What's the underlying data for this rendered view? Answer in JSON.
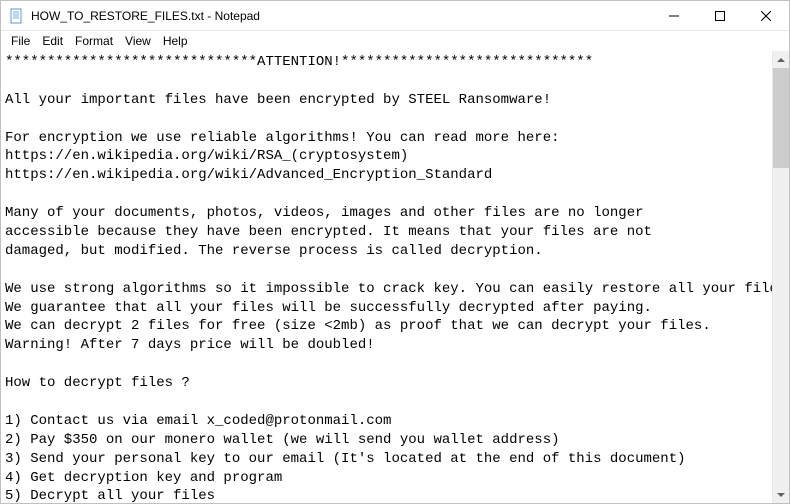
{
  "titlebar": {
    "title": "HOW_TO_RESTORE_FILES.txt - Notepad"
  },
  "menubar": {
    "items": [
      {
        "label": "File"
      },
      {
        "label": "Edit"
      },
      {
        "label": "Format"
      },
      {
        "label": "View"
      },
      {
        "label": "Help"
      }
    ]
  },
  "document": {
    "text": "******************************ATTENTION!******************************\n\nAll your important files have been encrypted by STEEL Ransomware!\n\nFor encryption we use reliable algorithms! You can read more here:\nhttps://en.wikipedia.org/wiki/RSA_(cryptosystem)\nhttps://en.wikipedia.org/wiki/Advanced_Encryption_Standard\n\nMany of your documents, photos, videos, images and other files are no longer\naccessible because they have been encrypted. It means that your files are not\ndamaged, but modified. The reverse process is called decryption.\n\nWe use strong algorithms so it impossible to crack key. You can easily restore all your files.\nWe guarantee that all your files will be successfully decrypted after paying.\nWe can decrypt 2 files for free (size <2mb) as proof that we can decrypt your files.\nWarning! After 7 days price will be doubled!\n\nHow to decrypt files ?\n\n1) Contact us via email x_coded@protonmail.com\n2) Pay $350 on our monero wallet (we will send you wallet address)\n3) Send your personal key to our email (It's located at the end of this document)\n4) Get decryption key and program\n5) Decrypt all your files"
  }
}
